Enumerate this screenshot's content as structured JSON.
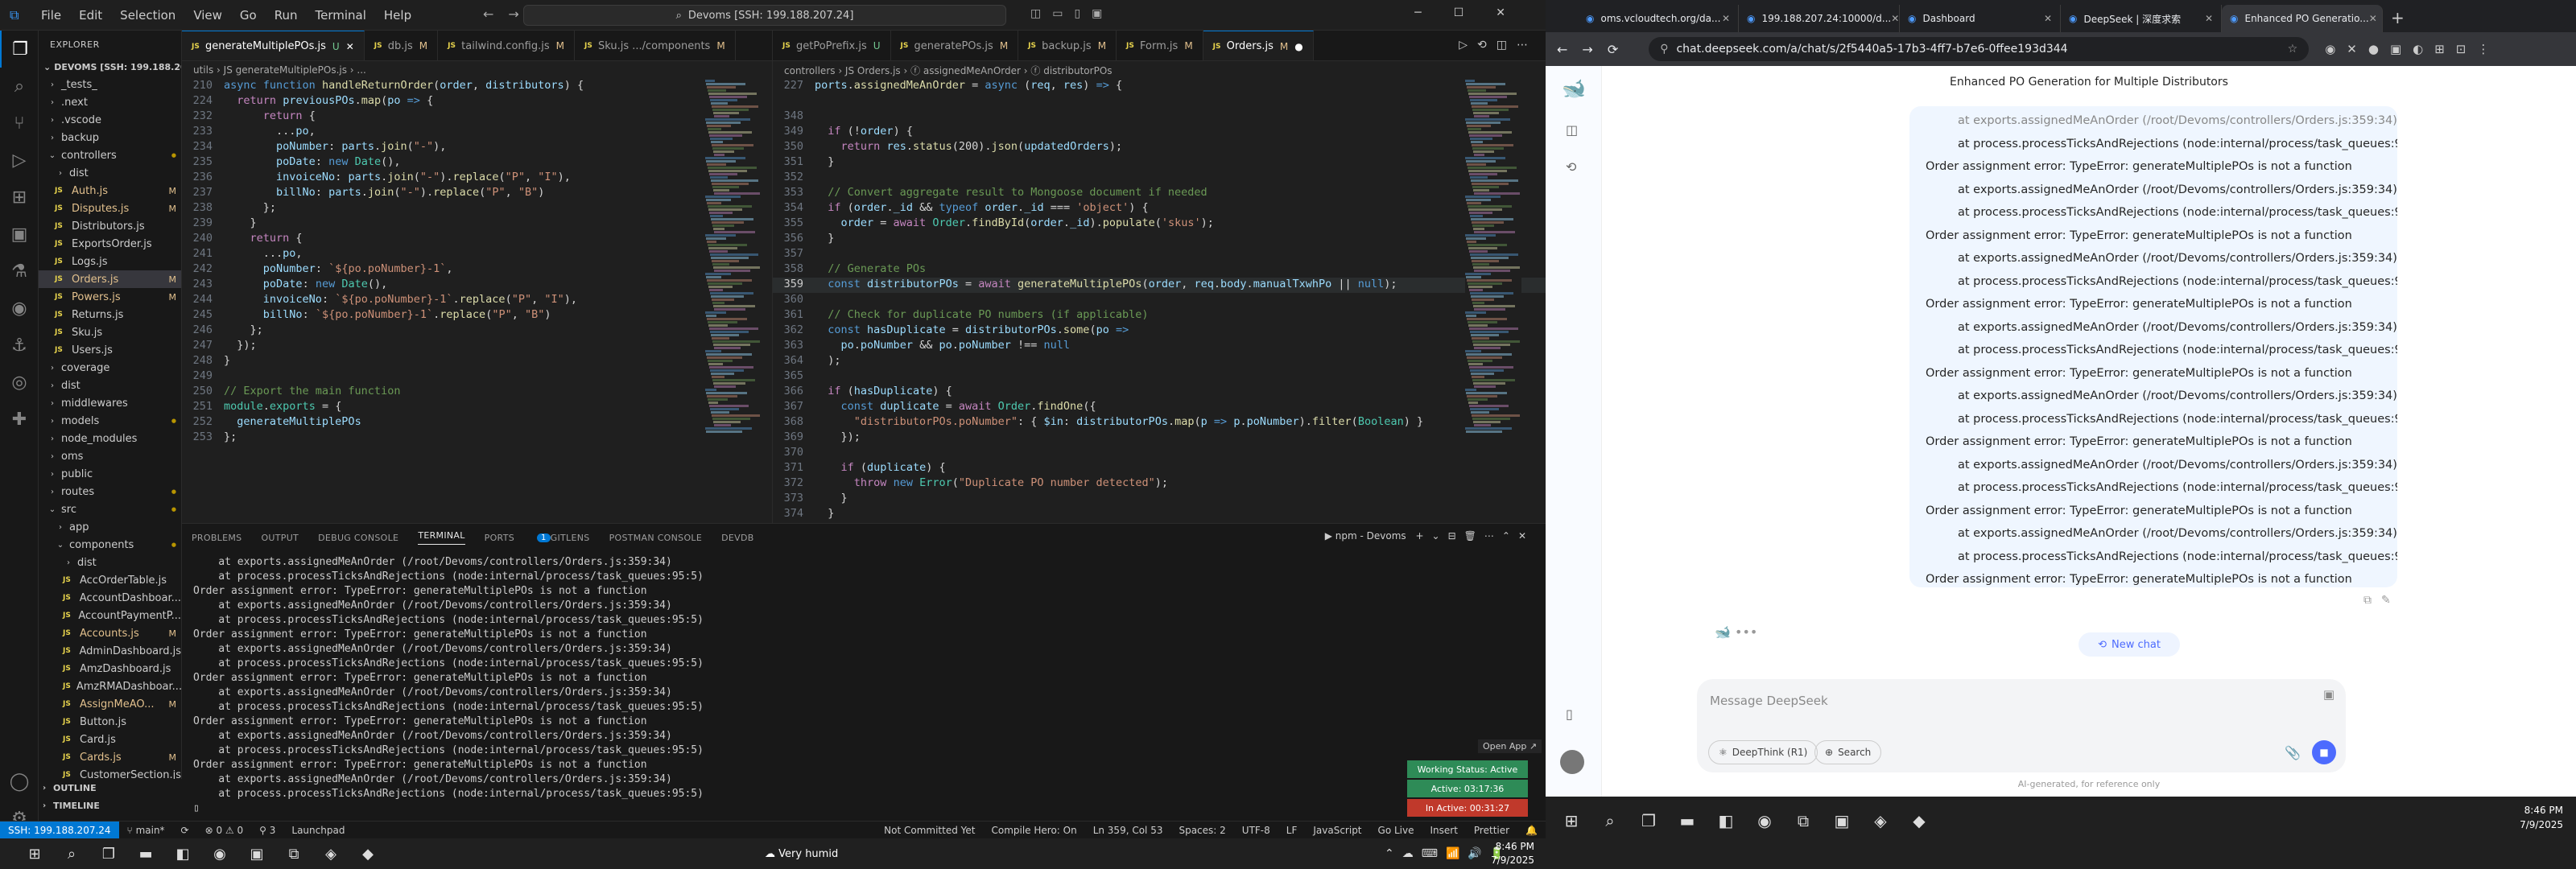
{
  "vscode": {
    "menus": [
      "File",
      "Edit",
      "Selection",
      "View",
      "Go",
      "Run",
      "Terminal",
      "Help"
    ],
    "command_center": "Devoms [SSH: 199.188.207.24]",
    "explorer_title": "EXPLORER",
    "root_folder": "DEVOMS [SSH: 199.188.20...",
    "tree": [
      {
        "name": "_tests_",
        "type": "folder",
        "depth": 1
      },
      {
        "name": ".next",
        "type": "folder",
        "depth": 1
      },
      {
        "name": ".vscode",
        "type": "folder",
        "depth": 1
      },
      {
        "name": "backup",
        "type": "folder",
        "depth": 1
      },
      {
        "name": "controllers",
        "type": "folder",
        "depth": 1,
        "open": true,
        "badge": "dot"
      },
      {
        "name": "dist",
        "type": "folder",
        "depth": 2
      },
      {
        "name": "Auth.js",
        "type": "js",
        "depth": 2,
        "badge": "M"
      },
      {
        "name": "Disputes.js",
        "type": "js",
        "depth": 2,
        "badge": "M"
      },
      {
        "name": "Distributors.js",
        "type": "js",
        "depth": 2
      },
      {
        "name": "ExportsOrder.js",
        "type": "js",
        "depth": 2
      },
      {
        "name": "Logs.js",
        "type": "js",
        "depth": 2
      },
      {
        "name": "Orders.js",
        "type": "js",
        "depth": 2,
        "badge": "M",
        "selected": true
      },
      {
        "name": "Powers.js",
        "type": "js",
        "depth": 2,
        "badge": "M"
      },
      {
        "name": "Returns.js",
        "type": "js",
        "depth": 2
      },
      {
        "name": "Sku.js",
        "type": "js",
        "depth": 2
      },
      {
        "name": "Users.js",
        "type": "js",
        "depth": 2
      },
      {
        "name": "coverage",
        "type": "folder",
        "depth": 1
      },
      {
        "name": "dist",
        "type": "folder",
        "depth": 1
      },
      {
        "name": "middlewares",
        "type": "folder",
        "depth": 1
      },
      {
        "name": "models",
        "type": "folder",
        "depth": 1,
        "badge": "dot"
      },
      {
        "name": "node_modules",
        "type": "folder",
        "depth": 1
      },
      {
        "name": "oms",
        "type": "folder",
        "depth": 1
      },
      {
        "name": "public",
        "type": "folder",
        "depth": 1
      },
      {
        "name": "routes",
        "type": "folder",
        "depth": 1,
        "badge": "dot"
      },
      {
        "name": "src",
        "type": "folder",
        "depth": 1,
        "open": true,
        "badge": "dot"
      },
      {
        "name": "app",
        "type": "folder",
        "depth": 2
      },
      {
        "name": "components",
        "type": "folder",
        "depth": 2,
        "open": true,
        "badge": "dot"
      },
      {
        "name": "dist",
        "type": "folder",
        "depth": 3
      },
      {
        "name": "AccOrderTable.js",
        "type": "js",
        "depth": 3
      },
      {
        "name": "AccountDashboar...",
        "type": "js",
        "depth": 3
      },
      {
        "name": "AccountPaymentP...",
        "type": "js",
        "depth": 3
      },
      {
        "name": "Accounts.js",
        "type": "js",
        "depth": 3,
        "badge": "M"
      },
      {
        "name": "AdminDashboard.js",
        "type": "js",
        "depth": 3
      },
      {
        "name": "AmzDashboard.js",
        "type": "js",
        "depth": 3
      },
      {
        "name": "AmzRMADashboar...",
        "type": "js",
        "depth": 3
      },
      {
        "name": "AssignMeAO...",
        "type": "js",
        "depth": 3,
        "badge": "M"
      },
      {
        "name": "Button.js",
        "type": "js",
        "depth": 3
      },
      {
        "name": "Card.js",
        "type": "js",
        "depth": 3
      },
      {
        "name": "Cards.js",
        "type": "js",
        "depth": 3,
        "badge": "M"
      },
      {
        "name": "CustomerSection.js",
        "type": "js",
        "depth": 3
      }
    ],
    "outline": [
      "OUTLINE",
      "TIMELINE"
    ],
    "left_tabs": [
      {
        "label": "generateMultiplePOs.js",
        "mark": "U",
        "active": true
      },
      {
        "label": "db.js",
        "mark": "M"
      },
      {
        "label": "tailwind.config.js",
        "mark": "M"
      },
      {
        "label": "Sku.js .../components",
        "mark": "M"
      }
    ],
    "left_breadcrumb": "utils › JS generateMultiplePOs.js › ...",
    "left_code": [
      {
        "n": "210",
        "h": "<span class='kw'>async function</span> <span class='fn'>handleReturnOrder</span>(<span class='vr'>order</span>, <span class='vr'>distributors</span>) {"
      },
      {
        "n": "224",
        "h": "  <span class='kc'>return</span> <span class='vr'>previousPOs</span>.<span class='fn'>map</span>(<span class='vr'>po</span> <span class='kw'>=&gt;</span> {"
      },
      {
        "n": "232",
        "h": "      <span class='kc'>return</span> {"
      },
      {
        "n": "233",
        "h": "        ...<span class='vr'>po</span>,"
      },
      {
        "n": "234",
        "h": "        <span class='vr'>poNumber</span>: <span class='vr'>parts</span>.<span class='fn'>join</span>(<span class='st'>\"-\"</span>),"
      },
      {
        "n": "235",
        "h": "        <span class='vr'>poDate</span>: <span class='kw'>new</span> <span class='ty'>Date</span>(),"
      },
      {
        "n": "236",
        "h": "        <span class='vr'>invoiceNo</span>: <span class='vr'>parts</span>.<span class='fn'>join</span>(<span class='st'>\"-\"</span>).<span class='fn'>replace</span>(<span class='st'>\"P\"</span>, <span class='st'>\"I\"</span>),"
      },
      {
        "n": "237",
        "h": "        <span class='vr'>billNo</span>: <span class='vr'>parts</span>.<span class='fn'>join</span>(<span class='st'>\"-\"</span>).<span class='fn'>replace</span>(<span class='st'>\"P\"</span>, <span class='st'>\"B\"</span>)"
      },
      {
        "n": "238",
        "h": "      };"
      },
      {
        "n": "239",
        "h": "    }"
      },
      {
        "n": "240",
        "h": "    <span class='kc'>return</span> {"
      },
      {
        "n": "241",
        "h": "      ...<span class='vr'>po</span>,"
      },
      {
        "n": "242",
        "h": "      <span class='vr'>poNumber</span>: <span class='st'>`${po.poNumber}-1`</span>,"
      },
      {
        "n": "243",
        "h": "      <span class='vr'>poDate</span>: <span class='kw'>new</span> <span class='ty'>Date</span>(),"
      },
      {
        "n": "244",
        "h": "      <span class='vr'>invoiceNo</span>: <span class='st'>`${po.poNumber}-1`</span>.<span class='fn'>replace</span>(<span class='st'>\"P\"</span>, <span class='st'>\"I\"</span>),"
      },
      {
        "n": "245",
        "h": "      <span class='vr'>billNo</span>: <span class='st'>`${po.poNumber}-1`</span>.<span class='fn'>replace</span>(<span class='st'>\"P\"</span>, <span class='st'>\"B\"</span>)"
      },
      {
        "n": "246",
        "h": "    };"
      },
      {
        "n": "247",
        "h": "  });"
      },
      {
        "n": "248",
        "h": "}"
      },
      {
        "n": "249",
        "h": ""
      },
      {
        "n": "250",
        "h": "<span class='cm'>// Export the main function</span>"
      },
      {
        "n": "251",
        "h": "<span class='ty'>module</span>.<span class='ty'>exports</span> = {"
      },
      {
        "n": "252",
        "h": "  <span class='vr'>generateMultiplePOs</span>"
      },
      {
        "n": "253",
        "h": "};"
      }
    ],
    "right_tabs": [
      {
        "label": "getPoPrefix.js",
        "mark": "U"
      },
      {
        "label": "generatePOs.js",
        "mark": "M"
      },
      {
        "label": "backup.js",
        "mark": "M"
      },
      {
        "label": "Form.js",
        "mark": "M"
      },
      {
        "label": "Orders.js",
        "mark": "M",
        "active": true
      }
    ],
    "right_breadcrumb": "controllers › JS Orders.js › ⓕ assignedMeAnOrder › ⓕ distributorPOs",
    "right_code": [
      {
        "n": "227",
        "h": "<span class='vr'>ports</span>.<span class='fn'>assignedMeAnOrder</span> = <span class='kw'>async</span> (<span class='vr'>req</span>, <span class='vr'>res</span>) <span class='kw'>=&gt;</span> {"
      },
      {
        "n": "",
        "h": ""
      },
      {
        "n": "348",
        "h": ""
      },
      {
        "n": "349",
        "h": "  <span class='kc'>if</span> (!<span class='vr'>order</span>) {"
      },
      {
        "n": "350",
        "h": "    <span class='kc'>return</span> <span class='vr'>res</span>.<span class='fn'>status</span>(200).<span class='fn'>json</span>(<span class='vr'>updatedOrders</span>);"
      },
      {
        "n": "351",
        "h": "  }"
      },
      {
        "n": "352",
        "h": ""
      },
      {
        "n": "353",
        "h": "  <span class='cm'>// Convert aggregate result to Mongoose document if needed</span>"
      },
      {
        "n": "354",
        "h": "  <span class='kc'>if</span> (<span class='vr'>order</span>.<span class='vr'>_id</span> &amp;&amp; <span class='kw'>typeof</span> <span class='vr'>order</span>.<span class='vr'>_id</span> === <span class='st'>'object'</span>) {"
      },
      {
        "n": "355",
        "h": "    <span class='vr'>order</span> = <span class='kc'>await</span> <span class='ty'>Order</span>.<span class='fn'>findById</span>(<span class='vr'>order</span>.<span class='vr'>_id</span>).<span class='fn'>populate</span>(<span class='st'>'skus'</span>);"
      },
      {
        "n": "356",
        "h": "  }"
      },
      {
        "n": "357",
        "h": ""
      },
      {
        "n": "358",
        "h": "  <span class='cm'>// Generate POs</span>"
      },
      {
        "n": "359",
        "h": "  <span class='kw'>const</span> <span class='vr'>distributorPOs</span> = <span class='kc'>await</span> <span class='fn'>generateMultiplePOs</span>(<span class='vr'>order</span>, <span class='vr'>req</span>.<span class='vr'>body</span>.<span class='vr'>manualTxwhPo</span> || <span class='kw'>null</span>);",
        "cur": true
      },
      {
        "n": "360",
        "h": ""
      },
      {
        "n": "361",
        "h": "  <span class='cm'>// Check for duplicate PO numbers (if applicable)</span>"
      },
      {
        "n": "362",
        "h": "  <span class='kw'>const</span> <span class='vr'>hasDuplicate</span> = <span class='vr'>distributorPOs</span>.<span class='fn'>some</span>(<span class='vr'>po</span> <span class='kw'>=&gt;</span>"
      },
      {
        "n": "363",
        "h": "    <span class='vr'>po</span>.<span class='vr'>poNumber</span> &amp;&amp; <span class='vr'>po</span>.<span class='vr'>poNumber</span> !== <span class='kw'>null</span>"
      },
      {
        "n": "364",
        "h": "  );"
      },
      {
        "n": "365",
        "h": ""
      },
      {
        "n": "366",
        "h": "  <span class='kc'>if</span> (<span class='vr'>hasDuplicate</span>) {"
      },
      {
        "n": "367",
        "h": "    <span class='kw'>const</span> <span class='vr'>duplicate</span> = <span class='kc'>await</span> <span class='ty'>Order</span>.<span class='fn'>findOne</span>({"
      },
      {
        "n": "368",
        "h": "      <span class='st'>\"distributorPOs.poNumber\"</span>: { <span class='vr'>$in</span>: <span class='vr'>distributorPOs</span>.<span class='fn'>map</span>(<span class='vr'>p</span> <span class='kw'>=&gt;</span> <span class='vr'>p</span>.<span class='vr'>poNumber</span>).<span class='fn'>filter</span>(<span class='ty'>Boolean</span>) }"
      },
      {
        "n": "369",
        "h": "    });"
      },
      {
        "n": "370",
        "h": ""
      },
      {
        "n": "371",
        "h": "    <span class='kc'>if</span> (<span class='vr'>duplicate</span>) {"
      },
      {
        "n": "372",
        "h": "      <span class='kc'>throw</span> <span class='kw'>new</span> <span class='ty'>Error</span>(<span class='st'>\"Duplicate PO number detected\"</span>);"
      },
      {
        "n": "373",
        "h": "    }"
      },
      {
        "n": "374",
        "h": "  }"
      },
      {
        "n": "375",
        "h": ""
      }
    ],
    "panel_tabs": [
      "PROBLEMS",
      "OUTPUT",
      "DEBUG CONSOLE",
      "TERMINAL",
      "PORTS",
      "GITLENS",
      "POSTMAN CONSOLE",
      "DEVDB"
    ],
    "panel_active": "TERMINAL",
    "ports_count": "1",
    "terminal_name": "npm - Devoms",
    "terminal_lines": [
      "    at exports.assignedMeAnOrder (/root/Devoms/controllers/Orders.js:359:34)",
      "    at process.processTicksAndRejections (node:internal/process/task_queues:95:5)",
      "Order assignment error: TypeError: generateMultiplePOs is not a function",
      "    at exports.assignedMeAnOrder (/root/Devoms/controllers/Orders.js:359:34)",
      "    at process.processTicksAndRejections (node:internal/process/task_queues:95:5)",
      "Order assignment error: TypeError: generateMultiplePOs is not a function",
      "    at exports.assignedMeAnOrder (/root/Devoms/controllers/Orders.js:359:34)",
      "    at process.processTicksAndRejections (node:internal/process/task_queues:95:5)",
      "Order assignment error: TypeError: generateMultiplePOs is not a function",
      "    at exports.assignedMeAnOrder (/root/Devoms/controllers/Orders.js:359:34)",
      "    at process.processTicksAndRejections (node:internal/process/task_queues:95:5)",
      "Order assignment error: TypeError: generateMultiplePOs is not a function",
      "    at exports.assignedMeAnOrder (/root/Devoms/controllers/Orders.js:359:34)",
      "    at process.processTicksAndRejections (node:internal/process/task_queues:95:5)",
      "Order assignment error: TypeError: generateMultiplePOs is not a function",
      "    at exports.assignedMeAnOrder (/root/Devoms/controllers/Orders.js:359:34)",
      "    at process.processTicksAndRejections (node:internal/process/task_queues:95:5)",
      "▯"
    ],
    "open_app": "Open App ↗",
    "working_status": "Working Status: Active",
    "active_time": "Active: 03:17:36",
    "inactive_time": "In Active: 00:31:27",
    "status": {
      "ssh": "SSH: 199.188.207.24",
      "branch": "main*",
      "sync": "⟳",
      "errors": "⊗ 0 ⚠ 0",
      "ports": "⚲ 3",
      "launchpad": "Launchpad",
      "not_committed": "Not Committed Yet",
      "compile_hero": "Compile Hero: On",
      "position": "Ln 359, Col 53",
      "spaces": "Spaces: 2",
      "encoding": "UTF-8",
      "eol": "LF",
      "language": "JavaScript",
      "golive": "Go Live",
      "insert": "Insert",
      "prettier": "Prettier"
    }
  },
  "chrome": {
    "tabs": [
      {
        "label": "oms.vcloudtech.org/da..."
      },
      {
        "label": "199.188.207.24:10000/d..."
      },
      {
        "label": "Dashboard"
      },
      {
        "label": "DeepSeek | 深度求索"
      },
      {
        "label": "Enhanced PO Generatio...",
        "active": true
      }
    ],
    "url": "chat.deepseek.com/a/chat/s/2f5440a5-17b3-4ff7-b7e6-0ffee193d344",
    "chat_title": "Enhanced PO Generation for Multiple Distributors",
    "bubble_lines": [
      {
        "t": "at exports.assignedMeAnOrder (/root/Devoms/controllers/Orders.js:359:34)",
        "ind": true
      },
      {
        "t": "at process.processTicksAndRejections (node:internal/process/task_queues:95:5)",
        "ind": true
      },
      {
        "t": "Order assignment error: TypeError: generateMultiplePOs is not a function",
        "ind": false
      },
      {
        "t": "at exports.assignedMeAnOrder (/root/Devoms/controllers/Orders.js:359:34)",
        "ind": true
      },
      {
        "t": "at process.processTicksAndRejections (node:internal/process/task_queues:95:5)",
        "ind": true
      },
      {
        "t": "Order assignment error: TypeError: generateMultiplePOs is not a function",
        "ind": false
      },
      {
        "t": "at exports.assignedMeAnOrder (/root/Devoms/controllers/Orders.js:359:34)",
        "ind": true
      },
      {
        "t": "at process.processTicksAndRejections (node:internal/process/task_queues:95:5)",
        "ind": true
      },
      {
        "t": "Order assignment error: TypeError: generateMultiplePOs is not a function",
        "ind": false
      },
      {
        "t": "at exports.assignedMeAnOrder (/root/Devoms/controllers/Orders.js:359:34)",
        "ind": true
      },
      {
        "t": "at process.processTicksAndRejections (node:internal/process/task_queues:95:5)",
        "ind": true
      },
      {
        "t": "Order assignment error: TypeError: generateMultiplePOs is not a function",
        "ind": false
      },
      {
        "t": "at exports.assignedMeAnOrder (/root/Devoms/controllers/Orders.js:359:34)",
        "ind": true
      },
      {
        "t": "at process.processTicksAndRejections (node:internal/process/task_queues:95:5)",
        "ind": true
      },
      {
        "t": "Order assignment error: TypeError: generateMultiplePOs is not a function",
        "ind": false
      },
      {
        "t": "at exports.assignedMeAnOrder (/root/Devoms/controllers/Orders.js:359:34)",
        "ind": true
      },
      {
        "t": "at process.processTicksAndRejections (node:internal/process/task_queues:95:5)",
        "ind": true
      },
      {
        "t": "Order assignment error: TypeError: generateMultiplePOs is not a function",
        "ind": false
      },
      {
        "t": "at exports.assignedMeAnOrder (/root/Devoms/controllers/Orders.js:359:34)",
        "ind": true
      },
      {
        "t": "at process.processTicksAndRejections (node:internal/process/task_queues:95:5)",
        "ind": true
      },
      {
        "t": "Order assignment error: TypeError: generateMultiplePOs is not a function",
        "ind": false
      }
    ],
    "new_chat": "New chat",
    "placeholder": "Message DeepSeek",
    "deepthink": "DeepThink (R1)",
    "search": "Search",
    "disclaimer": "AI-generated, for reference only"
  },
  "taskbar_right": {
    "time": "8:46 PM",
    "date": "7/9/2025"
  },
  "taskbar_left": {
    "weather": "Very humid",
    "time": "8:46 PM",
    "date": "7/9/2025"
  }
}
